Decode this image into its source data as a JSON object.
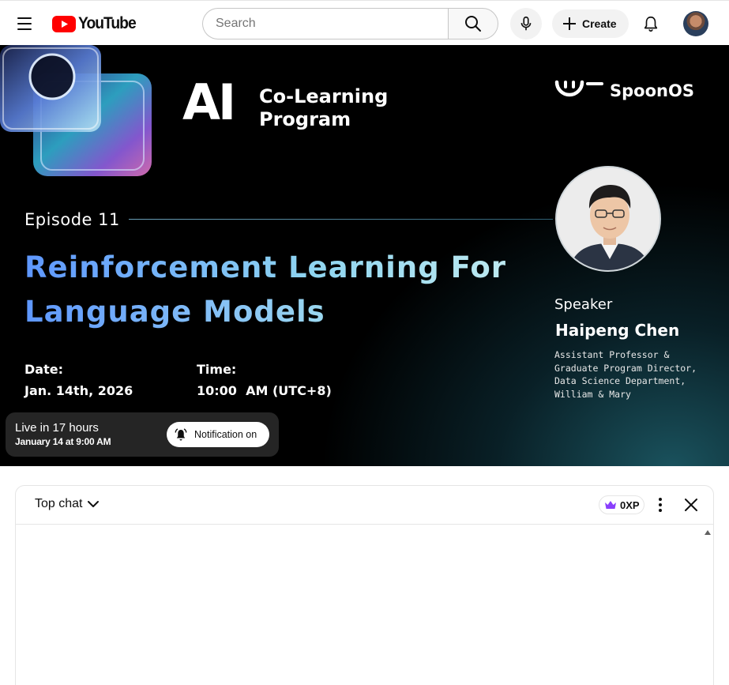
{
  "header": {
    "logo_text": "YouTube",
    "search_placeholder": "Search",
    "create_label": "Create"
  },
  "video": {
    "program": {
      "ai": "AI",
      "line1": "Co-Learning",
      "line2": "Program"
    },
    "brand": "SpoonOS",
    "episode": "Episode 11",
    "title_line1": "Reinforcement Learning For",
    "title_line2": "Language Models",
    "date_label": "Date:",
    "date_value": "Jan. 14th, 2026",
    "time_label": "Time:",
    "time_value": "10:00  AM (UTC+8)",
    "speaker_label": "Speaker",
    "speaker_name": "Haipeng Chen",
    "speaker_title": [
      "Assistant Professor &",
      "Graduate Program Director,",
      "Data Science Department,",
      "William & Mary"
    ],
    "live": {
      "main": "Live in 17 hours",
      "sub": "January 14 at 9:00 AM",
      "notification_label": "Notification on"
    }
  },
  "chat": {
    "mode_label": "Top chat",
    "xp_label": "0XP"
  },
  "colors": {
    "youtube_red": "#ff0000",
    "title_gradient_start": "#5e97ff",
    "title_gradient_end": "#bde9f0",
    "xp_crown": "#8a3ffc"
  },
  "icons": {
    "menu": "menu-icon",
    "search": "search-icon",
    "mic": "mic-icon",
    "create": "plus-icon",
    "bell": "bell-icon",
    "notification": "bell-ringing-icon",
    "chevron": "chevron-down-icon",
    "crown": "crown-icon",
    "kebab": "more-vert-icon",
    "close": "close-icon"
  }
}
